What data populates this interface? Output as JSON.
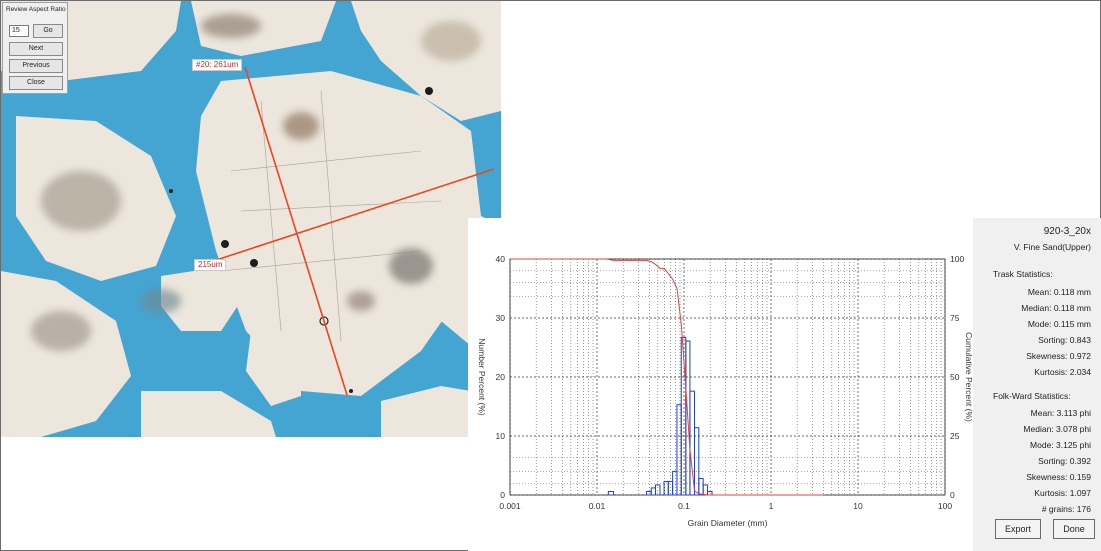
{
  "review_panel": {
    "title": "Review Aspect Ratio",
    "number_value": "15",
    "go_label": "Go",
    "next_label": "Next",
    "previous_label": "Previous",
    "close_label": "Close"
  },
  "measurements": [
    {
      "label": "#20:  261um"
    },
    {
      "label": "215um"
    }
  ],
  "stats_panel": {
    "sample_name": "920-3_20x",
    "classification": "V. Fine Sand(Upper)",
    "trask_heading": "Trask Statistics:",
    "trask": [
      "Mean: 0.118 mm",
      "Median: 0.118 mm",
      "Mode: 0.115 mm",
      "Sorting: 0.843",
      "Skewness: 0.972",
      "Kurtosis: 2.034"
    ],
    "folkward_heading": "Folk-Ward Statistics:",
    "folkward": [
      "Mean: 3.113 phi",
      "Median: 3.078 phi",
      "Mode: 3.125 phi",
      "Sorting: 0.392",
      "Skewness: 0.159",
      "Kurtosis: 1.097"
    ],
    "grains": "# grains: 176",
    "export_label": "Export",
    "done_label": "Done"
  },
  "chart_data": {
    "type": "bar",
    "xlabel": "Grain Diameter (mm)",
    "ylabel": "Number Percent (%)",
    "y2label": "Cumulative Percent (%)",
    "x_scale": "log",
    "xlim": [
      0.001,
      100
    ],
    "ylim": [
      0,
      40
    ],
    "y2lim": [
      0,
      100
    ],
    "x_ticks": [
      "0.001",
      "0.01",
      "0.1",
      "1",
      "10",
      "100"
    ],
    "x_tick_values": [
      0.001,
      0.01,
      0.1,
      1,
      10,
      100
    ],
    "y_ticks": [
      0,
      10,
      20,
      30,
      40
    ],
    "y2_ticks": [
      0,
      25,
      50,
      75,
      100
    ],
    "grid": true,
    "series": [
      {
        "kind": "histogram",
        "color": "#1f3fd0",
        "bins": [
          {
            "x0": 0.0135,
            "x1": 0.0155,
            "value": 0.6
          },
          {
            "x0": 0.037,
            "x1": 0.042,
            "value": 0.6
          },
          {
            "x0": 0.042,
            "x1": 0.047,
            "value": 1.2
          },
          {
            "x0": 0.047,
            "x1": 0.053,
            "value": 1.7
          },
          {
            "x0": 0.059,
            "x1": 0.066,
            "value": 2.3
          },
          {
            "x0": 0.066,
            "x1": 0.074,
            "value": 2.3
          },
          {
            "x0": 0.074,
            "x1": 0.083,
            "value": 4.0
          },
          {
            "x0": 0.083,
            "x1": 0.093,
            "value": 15.3
          },
          {
            "x0": 0.093,
            "x1": 0.105,
            "value": 26.7
          },
          {
            "x0": 0.105,
            "x1": 0.117,
            "value": 26.1
          },
          {
            "x0": 0.117,
            "x1": 0.132,
            "value": 17.6
          },
          {
            "x0": 0.132,
            "x1": 0.148,
            "value": 11.4
          },
          {
            "x0": 0.148,
            "x1": 0.166,
            "value": 2.8
          },
          {
            "x0": 0.166,
            "x1": 0.186,
            "value": 1.7
          },
          {
            "x0": 0.186,
            "x1": 0.21,
            "value": 0.6
          }
        ]
      },
      {
        "kind": "cumulative",
        "color": "#e04040",
        "points": [
          [
            0.001,
            100
          ],
          [
            0.013,
            100
          ],
          [
            0.0155,
            99.4
          ],
          [
            0.037,
            99.4
          ],
          [
            0.042,
            98.9
          ],
          [
            0.047,
            97.7
          ],
          [
            0.053,
            96.0
          ],
          [
            0.059,
            96.0
          ],
          [
            0.066,
            93.8
          ],
          [
            0.074,
            91.5
          ],
          [
            0.083,
            87.5
          ],
          [
            0.093,
            72.2
          ],
          [
            0.105,
            45.5
          ],
          [
            0.117,
            19.4
          ],
          [
            0.132,
            1.8
          ],
          [
            0.148,
            0.5
          ],
          [
            0.186,
            0.0
          ],
          [
            4,
            0.0
          ]
        ]
      }
    ]
  }
}
